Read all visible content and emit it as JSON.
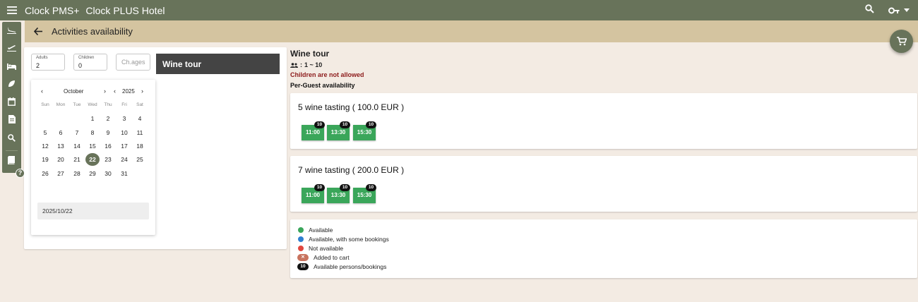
{
  "app": {
    "name": "Clock PMS+",
    "hotel": "Clock PLUS Hotel"
  },
  "icons": {
    "menu": "menu-icon",
    "search": "search-icon",
    "key": "key-icon",
    "caret": "caret-down-icon",
    "back": "arrow-back-icon",
    "cart": "cart-icon",
    "guests": "people-icon"
  },
  "colors": {
    "primary": "#68735a",
    "subbar": "#d4c4a0",
    "background": "#f3ebe3",
    "available": "#3aa65a",
    "some_bookings": "#2f7fd0",
    "not_available": "#e0473f",
    "in_cart": "#c8735e",
    "warning": "#8c1a1a"
  },
  "sidebar": {
    "items": [
      {
        "icon": "flight-land-icon"
      },
      {
        "icon": "flight-takeoff-icon"
      },
      {
        "icon": "bed-icon"
      },
      {
        "icon": "eco-leaf-icon"
      },
      {
        "icon": "calendar-icon"
      },
      {
        "icon": "document-icon"
      },
      {
        "icon": "search-icon"
      },
      {
        "icon": "book-icon"
      }
    ],
    "help": "?"
  },
  "page": {
    "title": "Activities availability"
  },
  "filters": {
    "adults_label": "Adults",
    "adults_value": "2",
    "children_label": "Children",
    "children_value": "0",
    "ages_placeholder": "Ch.ages"
  },
  "selected_activity": "Wine tour",
  "calendar": {
    "month": "October",
    "year": "2025",
    "weekdays": [
      "Sun",
      "Mon",
      "Tue",
      "Wed",
      "Thu",
      "Fri",
      "Sat"
    ],
    "first_weekday_index": 3,
    "days_in_month": 31,
    "selected_day": 22,
    "selected_date": "2025/10/22"
  },
  "activity": {
    "title": "Wine tour",
    "capacity": "1 ~ 10",
    "children_note": "Children are not allowed",
    "availability_mode": "Per-Guest availability",
    "offers": [
      {
        "name": "5 wine tasting ( 100.0 EUR )",
        "slots": [
          {
            "time": "11:00",
            "available": "10",
            "status": "available"
          },
          {
            "time": "13:30",
            "available": "10",
            "status": "available"
          },
          {
            "time": "15:30",
            "available": "10",
            "status": "available"
          }
        ]
      },
      {
        "name": "7 wine tasting ( 200.0 EUR )",
        "slots": [
          {
            "time": "11:00",
            "available": "10",
            "status": "available"
          },
          {
            "time": "13:30",
            "available": "10",
            "status": "available"
          },
          {
            "time": "15:30",
            "available": "10",
            "status": "available"
          }
        ]
      }
    ]
  },
  "legend": [
    {
      "label": "Available",
      "marker": "dot",
      "color": "#3aa65a"
    },
    {
      "label": "Available, with some bookings",
      "marker": "dot",
      "color": "#2f7fd0"
    },
    {
      "label": "Not available",
      "marker": "dot",
      "color": "#e0473f"
    },
    {
      "label": "Added to cart",
      "marker": "pill",
      "color": "#c8735e",
      "pill_icon": "cart-x-icon",
      "pill_text": "✕"
    },
    {
      "label": "Available persons/bookings",
      "marker": "pill",
      "color": "#111111",
      "pill_text": "10"
    }
  ]
}
